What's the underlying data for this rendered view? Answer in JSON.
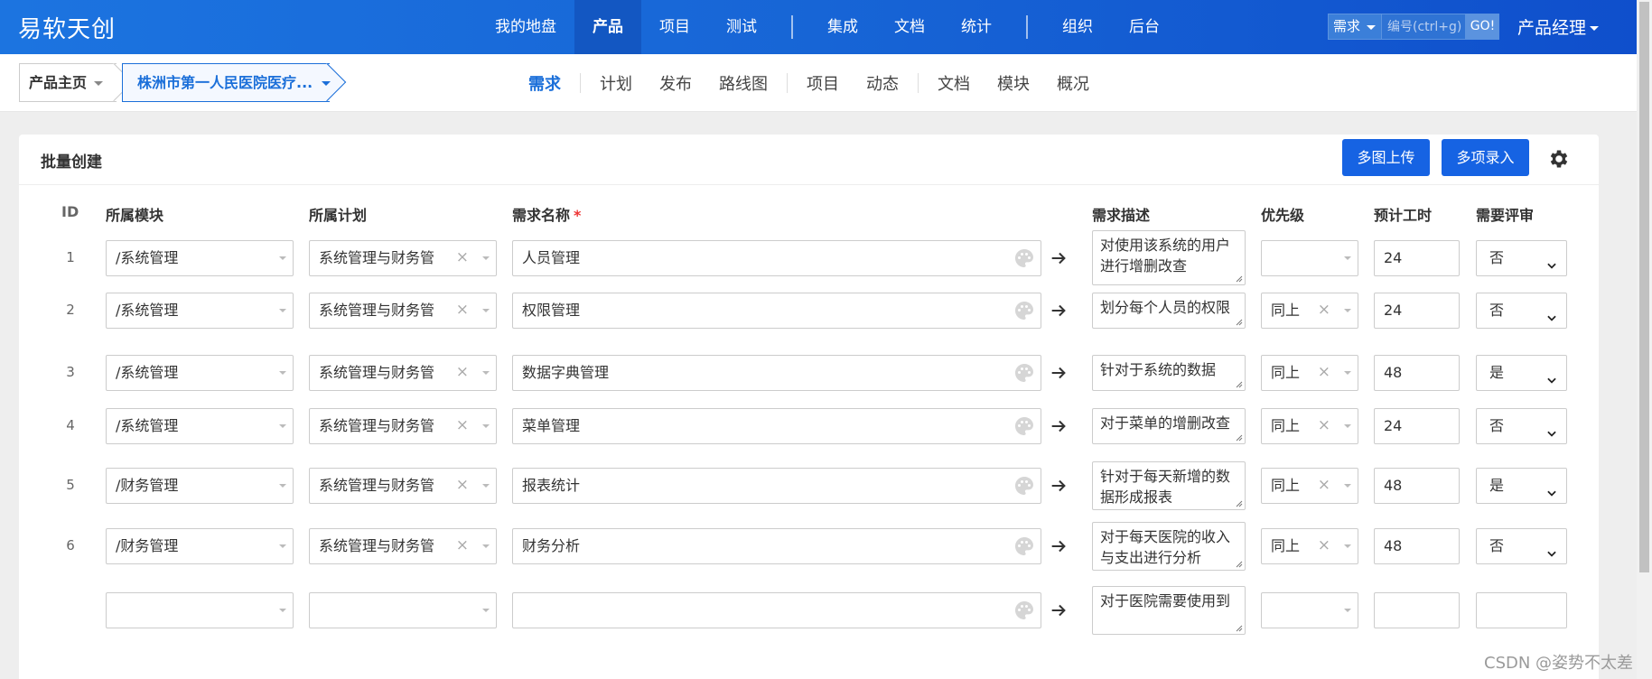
{
  "brand": "易软天创",
  "nav": {
    "items": [
      {
        "label": "我的地盘",
        "active": false
      },
      {
        "label": "产品",
        "active": true
      },
      {
        "label": "项目",
        "active": false
      },
      {
        "label": "测试",
        "active": false
      },
      {
        "sep": true
      },
      {
        "label": "集成",
        "active": false
      },
      {
        "label": "文档",
        "active": false
      },
      {
        "label": "统计",
        "active": false
      },
      {
        "sep": true
      },
      {
        "label": "组织",
        "active": false
      },
      {
        "label": "后台",
        "active": false
      }
    ]
  },
  "search": {
    "type": "需求",
    "placeholder": "编号(ctrl+g)",
    "go": "GO!"
  },
  "user": "产品经理",
  "breadcrumb": {
    "home": "产品主页",
    "product": "株洲市第一人民医院医疗..."
  },
  "subnav": {
    "items": [
      {
        "label": "需求",
        "active": true
      },
      {
        "sep": true
      },
      {
        "label": "计划"
      },
      {
        "label": "发布"
      },
      {
        "label": "路线图"
      },
      {
        "sep": true
      },
      {
        "label": "项目"
      },
      {
        "label": "动态"
      },
      {
        "sep": true
      },
      {
        "label": "文档"
      },
      {
        "label": "模块"
      },
      {
        "label": "概况"
      }
    ]
  },
  "panel": {
    "title": "批量创建",
    "btn_multi_upload": "多图上传",
    "btn_multi_entry": "多项录入"
  },
  "table": {
    "headers": {
      "id": "ID",
      "module": "所属模块",
      "plan": "所属计划",
      "name": "需求名称",
      "required_mark": "*",
      "desc": "需求描述",
      "priority": "优先级",
      "estimate": "预计工时",
      "review": "需要评审"
    },
    "rows": [
      {
        "id": "1",
        "module": "/系统管理",
        "plan": "系统管理与财务管",
        "name": "人员管理",
        "desc": "对使用该系统的用户进行增删改查",
        "priority": "",
        "estimate": "24",
        "review": "否"
      },
      {
        "id": "2",
        "module": "/系统管理",
        "plan": "系统管理与财务管",
        "name": "权限管理",
        "desc": "划分每个人员的权限",
        "priority": "同上",
        "estimate": "24",
        "review": "否"
      },
      {
        "id": "3",
        "module": "/系统管理",
        "plan": "系统管理与财务管",
        "name": "数据字典管理",
        "desc": "针对于系统的数据",
        "priority": "同上",
        "estimate": "48",
        "review": "是"
      },
      {
        "id": "4",
        "module": "/系统管理",
        "plan": "系统管理与财务管",
        "name": "菜单管理",
        "desc": "对于菜单的增删改查",
        "priority": "同上",
        "estimate": "24",
        "review": "否"
      },
      {
        "id": "5",
        "module": "/财务管理",
        "plan": "系统管理与财务管",
        "name": "报表统计",
        "desc": "针对于每天新增的数据形成报表",
        "priority": "同上",
        "estimate": "48",
        "review": "是"
      },
      {
        "id": "6",
        "module": "/财务管理",
        "plan": "系统管理与财务管",
        "name": "财务分析",
        "desc": "对于每天医院的收入与支出进行分析",
        "priority": "同上",
        "estimate": "48",
        "review": "否"
      },
      {
        "id": "",
        "module": "",
        "plan": "",
        "name": "",
        "desc": "对于医院需要使用到",
        "priority": "",
        "estimate": "",
        "review": ""
      }
    ]
  },
  "watermark": "CSDN @姿势不太差"
}
